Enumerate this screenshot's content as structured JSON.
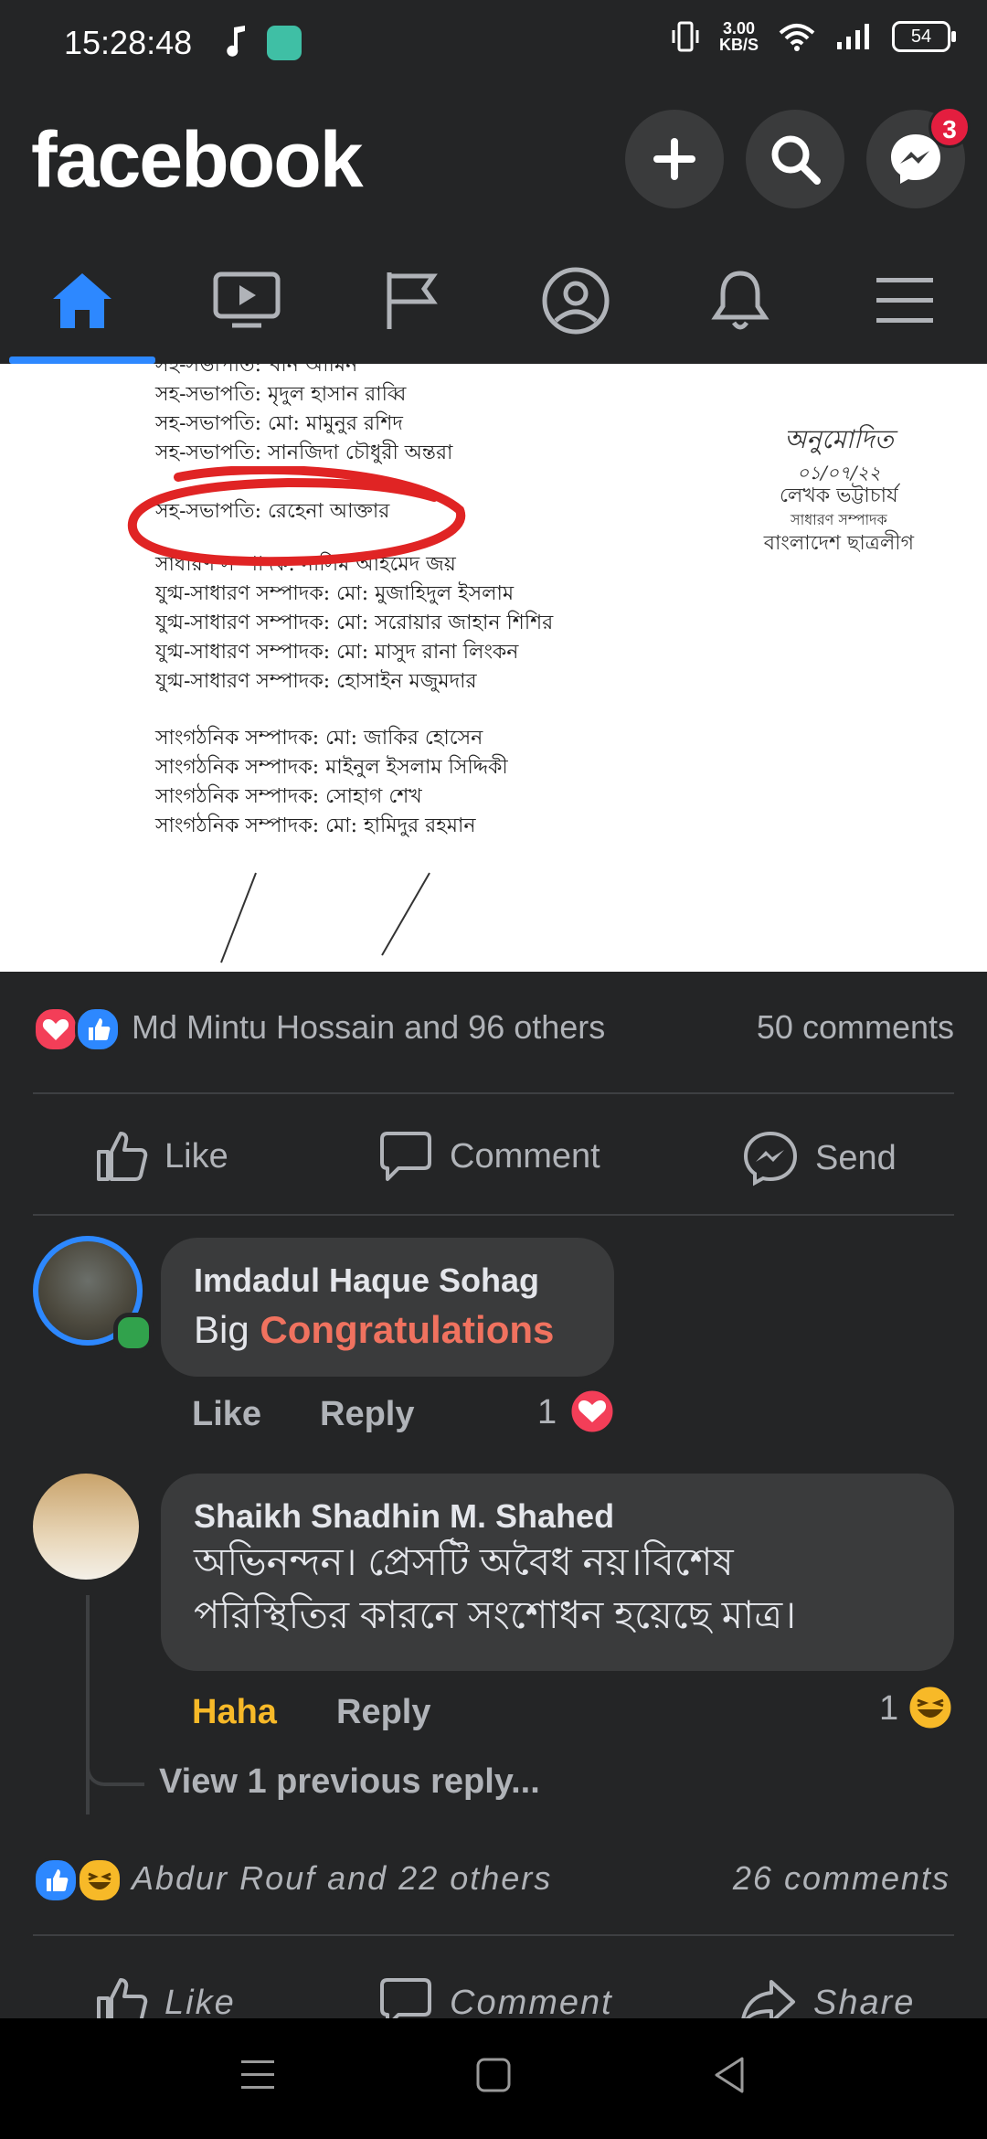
{
  "status": {
    "time": "15:28:48",
    "speed": "3.00",
    "speed_unit": "KB/S",
    "battery": "54"
  },
  "header": {
    "logo": "facebook",
    "messenger_badge": "3"
  },
  "tabs": [
    "home",
    "watch",
    "pages",
    "profile",
    "notifications",
    "menu"
  ],
  "doc": {
    "lines": [
      "সহ-সভাপতি: খান আমিন",
      "সহ-সভাপতি: মৃদুল হাসান রাব্বি",
      "সহ-সভাপতি: মো: মামুনুর রশিদ",
      "সহ-সভাপতি: সানজিদা চৌধুরী অন্তরা",
      "সহ-সভাপতি: রেহেনা আক্তার",
      "",
      "সাধারণ সম্পাদক: নাসিম আহমেদ জয়",
      "যুগ্ম-সাধারণ সম্পাদক: মো: মুজাহিদুল ইসলাম",
      "যুগ্ম-সাধারণ সম্পাদক: মো: সরোয়ার জাহান শিশির",
      "যুগ্ম-সাধারণ সম্পাদক: মো: মাসুদ রানা লিংকন",
      "যুগ্ম-সাধারণ সম্পাদক: হোসাইন মজুমদার",
      "",
      "সাংগঠনিক সম্পাদক: মো: জাকির হোসেন",
      "সাংগঠনিক সম্পাদক: মাইনুল ইসলাম সিদ্দিকী",
      "সাংগঠনিক সম্পাদক: সোহাগ শেখ",
      "সাংগঠনিক সম্পাদক: মো: হামিদুর রহমান"
    ],
    "sig_line1": "অনুমোদিত",
    "sig_date": "০১/০৭/২২",
    "sig_line2": "লেখক ভট্টাচার্য",
    "sig_line3": "সাধারণ সম্পাদক",
    "sig_line4": "বাংলাদেশ ছাত্রলীগ"
  },
  "post": {
    "reactions_text": "Md Mintu Hossain and 96 others",
    "comments_count": "50 comments",
    "actions": {
      "like": "Like",
      "comment": "Comment",
      "send": "Send"
    }
  },
  "comments": [
    {
      "name": "Imdadul Haque Sohag",
      "text_plain": "Big",
      "text_highlight": "Congratulations",
      "like": "Like",
      "reply": "Reply",
      "reaction_count": "1"
    },
    {
      "name": "Shaikh Shadhin M. Shahed",
      "text_line1": "অভিনন্দন। প্রেসটি অবৈধ নয়।বিশেষ",
      "text_line2": "পরিস্থিতির কারনে সংশোধন হয়েছে মাত্র।",
      "like": "Haha",
      "reply": "Reply",
      "reaction_count": "1",
      "view_previous": "View 1 previous reply..."
    }
  ],
  "post2": {
    "reactions_text": "Abdur Rouf and 22 others",
    "comments_count": "26 comments",
    "actions": {
      "like": "Like",
      "comment": "Comment",
      "share": "Share"
    }
  },
  "colors": {
    "accent": "#2d88ff",
    "haha": "#f7b928",
    "love": "#f33e58",
    "highlight_text": "#f0725f"
  }
}
